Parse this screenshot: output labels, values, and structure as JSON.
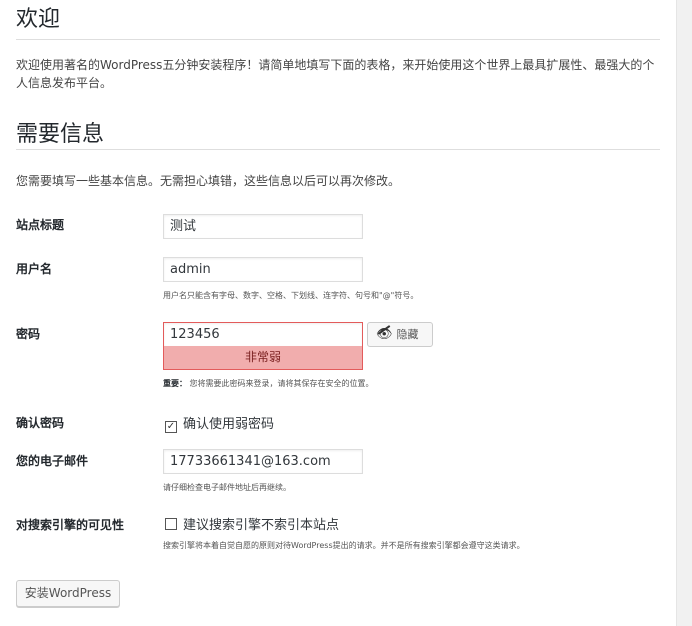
{
  "welcome": {
    "title": "欢迎",
    "intro": "欢迎使用著名的WordPress五分钟安装程序！请简单地填写下面的表格，来开始使用这个世界上最具扩展性、最强大的个人信息发布平台。"
  },
  "info": {
    "title": "需要信息",
    "desc": "您需要填写一些基本信息。无需担心填错，这些信息以后可以再次修改。"
  },
  "form": {
    "site_title": {
      "label": "站点标题",
      "value": "测试"
    },
    "username": {
      "label": "用户名",
      "value": "admin",
      "hint": "用户名只能含有字母、数字、空格、下划线、连字符、句号和\"@\"符号。"
    },
    "password": {
      "label": "密码",
      "value": "123456",
      "hide_label": "隐藏",
      "strength": "非常弱",
      "hint_strong": "重要：",
      "hint": "您将需要此密码来登录，请将其保存在安全的位置。"
    },
    "confirm_password": {
      "label": "确认密码",
      "checkbox_label": "确认使用弱密码",
      "checked": true
    },
    "email": {
      "label": "您的电子邮件",
      "value": "17733661341@163.com",
      "hint": "请仔细检查电子邮件地址后再继续。"
    },
    "search_visibility": {
      "label": "对搜索引擎的可见性",
      "checkbox_label": "建议搜索引擎不索引本站点",
      "checked": false,
      "hint": "搜索引擎将本着自觉自愿的原则对待WordPress提出的请求。并不是所有搜索引擎都会遵守这类请求。"
    }
  },
  "install_button": "安装WordPress",
  "colors": {
    "weak_bg": "#f1adad",
    "weak_border": "#e35b5b",
    "text": "#444444"
  },
  "icons": {
    "hide": "eye-slash-icon",
    "check": "checkmark"
  }
}
